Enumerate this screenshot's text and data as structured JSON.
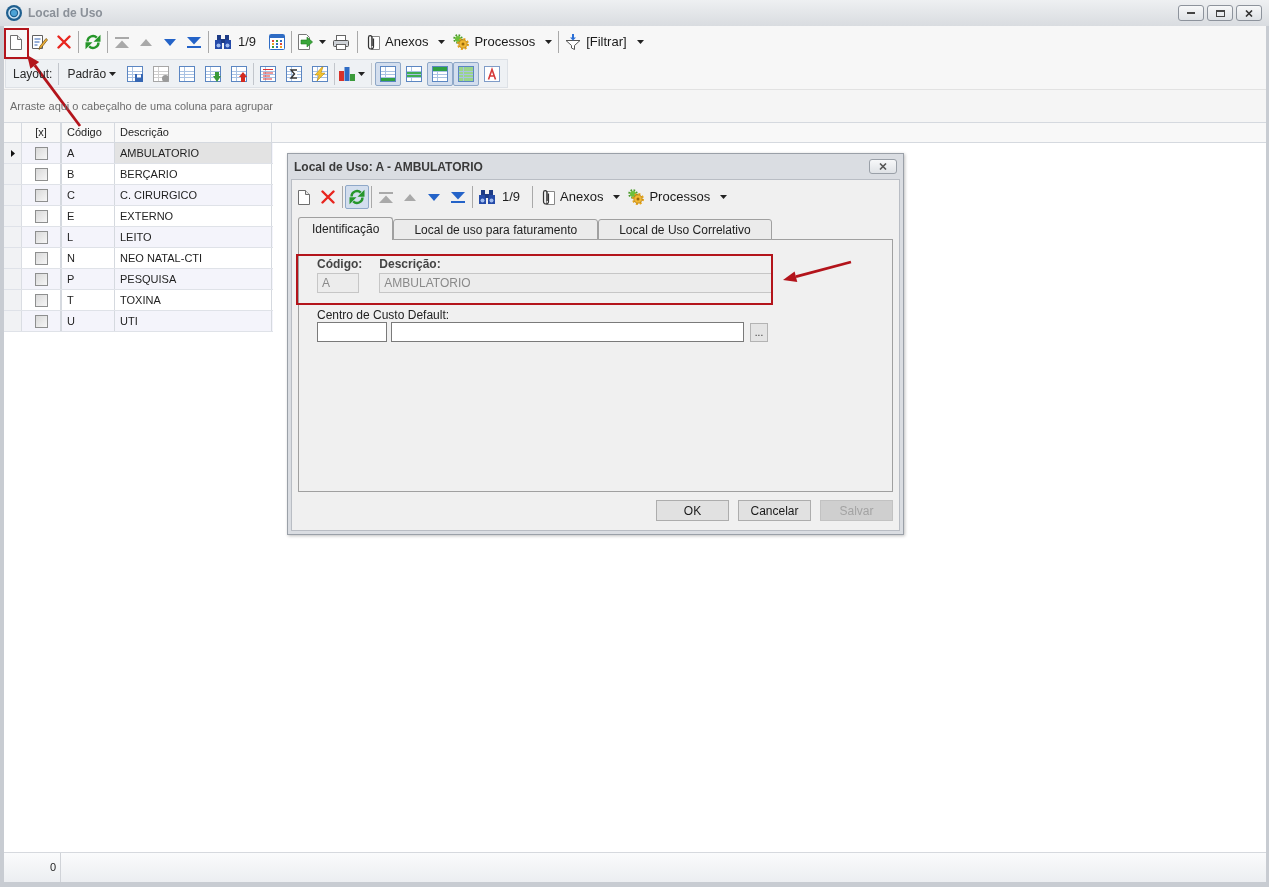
{
  "window": {
    "title": "Local de Uso"
  },
  "main_toolbar": {
    "nav_buttons": [
      {
        "disabled": true
      },
      {
        "disabled": true
      },
      {
        "disabled": false
      },
      {
        "disabled": false
      }
    ],
    "record_counter": "1/9",
    "menus": [
      {
        "label": "Anexos"
      },
      {
        "label": "Processos"
      },
      {
        "label": "[Filtrar]"
      }
    ]
  },
  "layout_toolbar": {
    "label": "Layout:",
    "preset": "Padrão",
    "view_toggles": [
      {
        "pressed": true
      },
      {
        "pressed": false
      },
      {
        "pressed": true
      },
      {
        "pressed": true
      },
      {
        "pressed": false
      }
    ]
  },
  "grid": {
    "group_panel_hint": "Arraste aqui o cabeçalho de uma coluna para agrupar",
    "columns": [
      "[x]",
      "Código",
      "Descrição"
    ],
    "rows": [
      {
        "checked": false,
        "code": "A",
        "description": "AMBULATORIO",
        "selected": true
      },
      {
        "checked": false,
        "code": "B",
        "description": "BERÇARIO",
        "selected": false
      },
      {
        "checked": false,
        "code": "C",
        "description": "C. CIRURGICO",
        "selected": false
      },
      {
        "checked": false,
        "code": "E",
        "description": "EXTERNO",
        "selected": false
      },
      {
        "checked": false,
        "code": "L",
        "description": "LEITO",
        "selected": false
      },
      {
        "checked": false,
        "code": "N",
        "description": "NEO NATAL-CTI",
        "selected": false
      },
      {
        "checked": false,
        "code": "P",
        "description": "PESQUISA",
        "selected": false
      },
      {
        "checked": false,
        "code": "T",
        "description": "TOXINA",
        "selected": false
      },
      {
        "checked": false,
        "code": "U",
        "description": "UTI",
        "selected": false
      }
    ]
  },
  "status_bar": {
    "record_count": "0"
  },
  "dialog": {
    "title": "Local de Uso: A - AMBULATORIO",
    "toolbar": {
      "refresh_pressed": true,
      "nav_buttons": [
        {
          "disabled": true
        },
        {
          "disabled": true
        },
        {
          "disabled": false
        },
        {
          "disabled": false
        }
      ],
      "record_counter": "1/9",
      "menus": [
        {
          "label": "Anexos"
        },
        {
          "label": "Processos"
        }
      ]
    },
    "tabs": [
      {
        "label": "Identificação",
        "selected": true
      },
      {
        "label": "Local de uso para faturamento",
        "selected": false
      },
      {
        "label": "Local de Uso Correlativo",
        "selected": false
      }
    ],
    "fields": [
      {
        "label": "Código:",
        "value": "A",
        "disabled": true
      },
      {
        "label": "Descrição:",
        "value": "AMBULATORIO",
        "disabled": true
      }
    ],
    "cost_center": {
      "label": "Centro de Custo Default:",
      "lookup_button": "..."
    },
    "buttons": [
      {
        "label": "OK",
        "disabled": false
      },
      {
        "label": "Cancelar",
        "disabled": false
      },
      {
        "label": "Salvar",
        "disabled": true
      }
    ]
  }
}
